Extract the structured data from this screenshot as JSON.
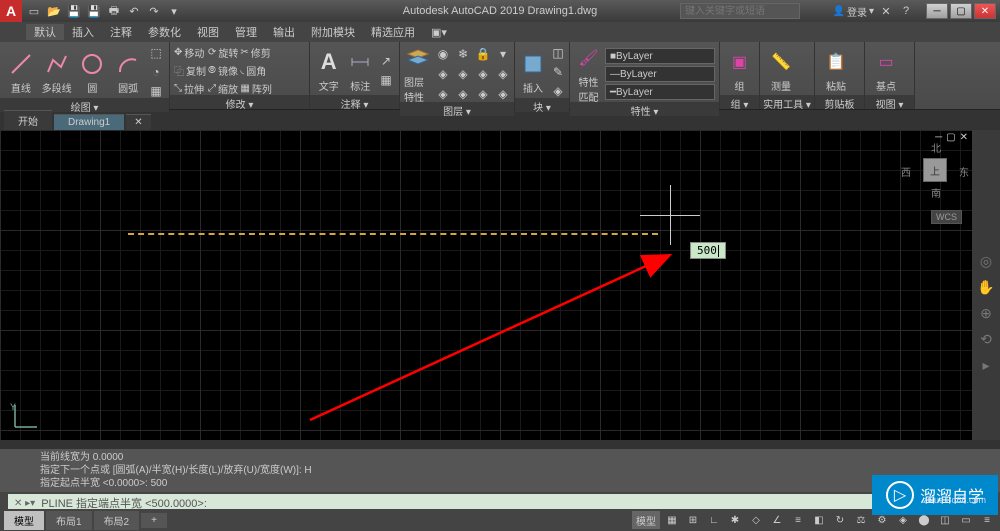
{
  "app": {
    "logo_letter": "A",
    "title": "Autodesk AutoCAD 2019   Drawing1.dwg",
    "search_placeholder": "键入关键字或短语",
    "login": "登录"
  },
  "menu": {
    "items": [
      "默认",
      "插入",
      "注释",
      "参数化",
      "视图",
      "管理",
      "输出",
      "附加模块",
      "精选应用"
    ],
    "active_index": 0
  },
  "ribbon": {
    "draw": {
      "label": "绘图 ▾",
      "line": "直线",
      "pline": "多段线",
      "circle": "圆",
      "arc": "圆弧"
    },
    "modify": {
      "label": "修改 ▾",
      "move": "移动",
      "rotate": "旋转",
      "trim": "修剪",
      "copy": "复制",
      "mirror": "镜像",
      "fillet": "圆角",
      "stretch": "拉伸",
      "scale": "缩放",
      "array": "阵列"
    },
    "annotation": {
      "label": "注释 ▾",
      "text": "文字",
      "dim": "标注"
    },
    "layers": {
      "label": "图层 ▾",
      "props": "图层特性"
    },
    "block": {
      "label": "块 ▾",
      "insert": "插入"
    },
    "properties": {
      "label": "特性 ▾",
      "match": "特性\n匹配",
      "bylayer": "ByLayer"
    },
    "group": {
      "label": "组 ▾",
      "group": "组"
    },
    "utilities": {
      "label": "实用工具 ▾",
      "measure": "测量"
    },
    "clipboard": {
      "label": "剪贴板",
      "paste": "粘贴"
    },
    "view": {
      "label": "视图 ▾",
      "base": "基点"
    }
  },
  "tabs": {
    "items": [
      "开始",
      "Drawing1"
    ],
    "active_index": 1
  },
  "drawing": {
    "input_value": "500"
  },
  "viewcube": {
    "top": "上",
    "n": "北",
    "s": "南",
    "e": "东",
    "w": "西",
    "wcs": "WCS"
  },
  "cmdline": {
    "h1": "当前线宽为 0.0000",
    "h2": "指定下一个点或 [圆弧(A)/半宽(H)/长度(L)/放弃(U)/宽度(W)]: H",
    "h3": "指定起点半宽 <0.0000>: 500",
    "prompt": "PLINE 指定端点半宽 <500.0000>:"
  },
  "status": {
    "model": "模型",
    "layout1": "布局1",
    "layout2": "布局2",
    "model2": "模型"
  },
  "watermark": {
    "brand": "溜溜自学",
    "url": "zixue.3d66.com"
  }
}
